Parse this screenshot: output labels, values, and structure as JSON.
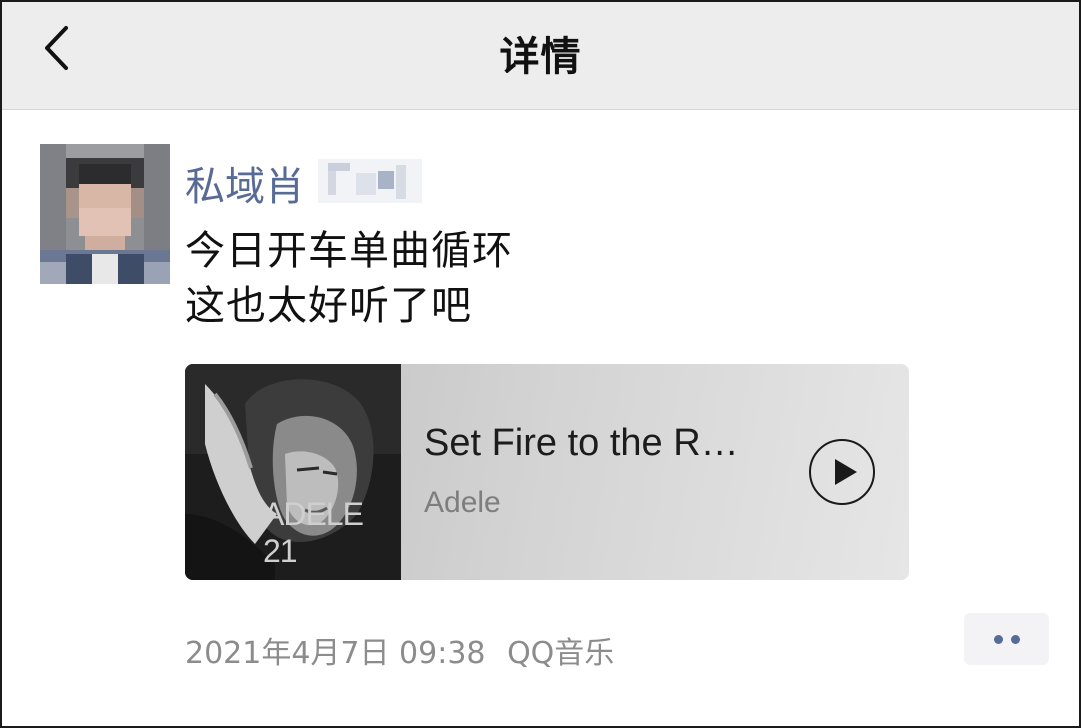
{
  "header": {
    "title": "详情",
    "back_icon": "chevron-left-icon"
  },
  "post": {
    "username": "私域肖",
    "lines": [
      "今日开车单曲循环",
      "这也太好听了吧"
    ],
    "music_card": {
      "cover_text": "ADELE 21",
      "title": "Set Fire to the R…",
      "artist": "Adele",
      "play_icon": "play-icon"
    },
    "timestamp": "2021年4月7日 09:38",
    "source": "QQ音乐",
    "more_icon": "more-dots-icon"
  },
  "colors": {
    "link_blue": "#576b95",
    "header_bg": "#ededed",
    "meta_gray": "#8c8c8c"
  }
}
